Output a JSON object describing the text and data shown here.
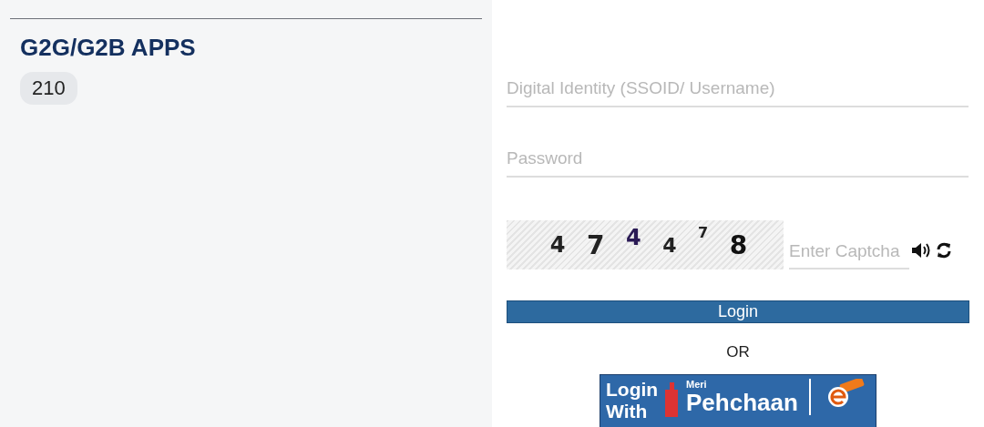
{
  "apps_panel": {
    "title": "G2G/G2B APPS",
    "count": "210"
  },
  "login_form": {
    "username": {
      "placeholder": "Digital Identity (SSOID/ Username)"
    },
    "password": {
      "placeholder": "Password"
    },
    "captcha": {
      "digits": [
        "4",
        "7",
        "4",
        "4",
        "7",
        "8"
      ],
      "input": {
        "placeholder": "Enter Captcha"
      }
    },
    "login_button": "Login",
    "separator": "OR",
    "alt_login": {
      "prefix": "Login With",
      "brand_small": "Meri",
      "brand": "Pehchaan"
    }
  }
}
